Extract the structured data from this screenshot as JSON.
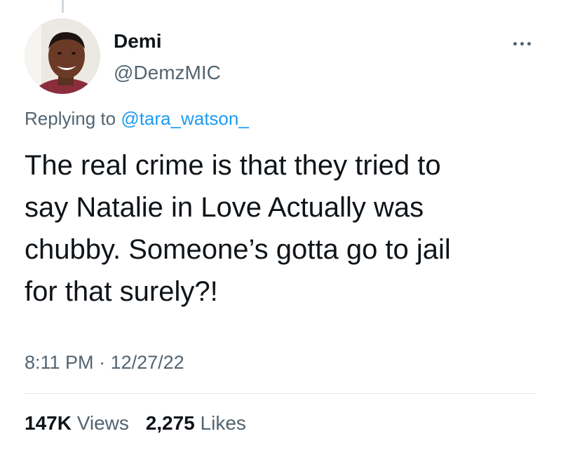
{
  "author": {
    "display_name": "Demi",
    "handle": "@DemzMIC",
    "avatar_icon": "profile-photo"
  },
  "reply": {
    "prefix": "Replying to",
    "to_handle": "@tara_watson_"
  },
  "tweet": {
    "text_lines": [
      "The real crime is that they tried to",
      "say Natalie in Love Actually was",
      "chubby. Someone’s gotta go to jail",
      "for that surely?!"
    ]
  },
  "meta": {
    "time": "8:11 PM",
    "separator": "·",
    "date": "12/27/22"
  },
  "stats": {
    "views_count": "147K",
    "views_label": "Views",
    "likes_count": "2,275",
    "likes_label": "Likes"
  },
  "colors": {
    "text_primary": "#0f1419",
    "text_secondary": "#536471",
    "link": "#1d9bf0"
  }
}
